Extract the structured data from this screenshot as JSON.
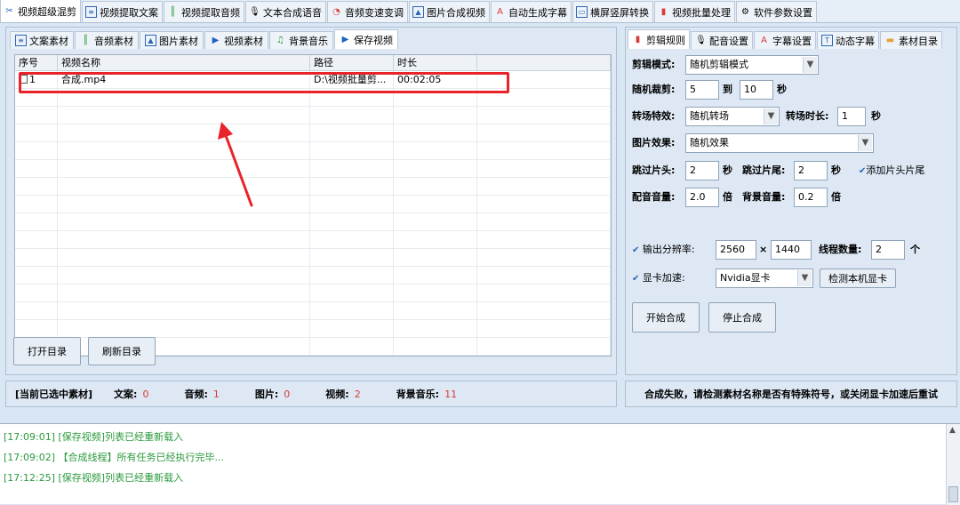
{
  "top_tabs": [
    {
      "label": "视频超级混剪",
      "icon": "scissors-icon",
      "active": true
    },
    {
      "label": "视频提取文案",
      "icon": "document-icon"
    },
    {
      "label": "视频提取音频",
      "icon": "audio-wave-icon"
    },
    {
      "label": "文本合成语音",
      "icon": "microphone-icon"
    },
    {
      "label": "音频变速变调",
      "icon": "speed-gauge-icon"
    },
    {
      "label": "图片合成视频",
      "icon": "image-icon"
    },
    {
      "label": "自动生成字幕",
      "icon": "subtitle-icon"
    },
    {
      "label": "横屏竖屏转换",
      "icon": "rotate-screen-icon"
    },
    {
      "label": "视频批量处理",
      "icon": "film-icon"
    },
    {
      "label": "软件参数设置",
      "icon": "gear-icon"
    }
  ],
  "sub_tabs": [
    {
      "label": "文案素材",
      "icon": "document-icon"
    },
    {
      "label": "音频素材",
      "icon": "audio-wave-icon"
    },
    {
      "label": "图片素材",
      "icon": "image-icon"
    },
    {
      "label": "视频素材",
      "icon": "play-icon"
    },
    {
      "label": "背景音乐",
      "icon": "music-note-icon"
    },
    {
      "label": "保存视频",
      "icon": "play-box-icon",
      "active": true
    }
  ],
  "table": {
    "headers": [
      "序号",
      "视频名称",
      "路径",
      "时长",
      ""
    ],
    "rows": [
      {
        "index": "1",
        "name": "合成.mp4",
        "path": "D:\\视频批量剪...",
        "duration": "00:02:05"
      }
    ]
  },
  "buttons": {
    "open_dir": "打开目录",
    "refresh_dir": "刷新目录"
  },
  "right_tabs": [
    {
      "label": "剪辑规则",
      "icon": "film-icon",
      "active": true
    },
    {
      "label": "配音设置",
      "icon": "microphone-icon"
    },
    {
      "label": "字幕设置",
      "icon": "subtitle-icon"
    },
    {
      "label": "动态字幕",
      "icon": "text-box-icon"
    },
    {
      "label": "素材目录",
      "icon": "folder-icon"
    }
  ],
  "settings": {
    "edit_mode_label": "剪辑模式:",
    "edit_mode_value": "随机剪辑模式",
    "random_cut_label": "随机裁剪:",
    "random_cut_from": "5",
    "to_label": "到",
    "random_cut_to": "10",
    "sec_unit": "秒",
    "transition_label": "转场特效:",
    "transition_value": "随机转场",
    "transition_duration_label": "转场时长:",
    "transition_duration_value": "1",
    "image_effect_label": "图片效果:",
    "image_effect_value": "随机效果",
    "skip_head_label": "跳过片头:",
    "skip_head_value": "2",
    "skip_tail_label": "跳过片尾:",
    "skip_tail_value": "2",
    "add_head_tail_label": "添加片头片尾",
    "voice_volume_label": "配音音量:",
    "voice_volume_value": "2.0",
    "times_unit": "倍",
    "bgm_volume_label": "背景音量:",
    "bgm_volume_value": "0.2",
    "output_res_label": "输出分辨率:",
    "res_width": "2560",
    "res_x": "×",
    "res_height": "1440",
    "threads_label": "线程数量:",
    "threads_value": "2",
    "threads_unit": "个",
    "gpu_label": "显卡加速:",
    "gpu_value": "Nvidia显卡",
    "detect_gpu_button": "检测本机显卡",
    "start_button": "开始合成",
    "stop_button": "停止合成"
  },
  "status": {
    "selected_label": "[当前已选中素材]",
    "text_label": "文案:",
    "text_count": "0",
    "audio_label": "音频:",
    "audio_count": "1",
    "image_label": "图片:",
    "image_count": "0",
    "video_label": "视频:",
    "video_count": "2",
    "bgm_label": "背景音乐:",
    "bgm_count": "11",
    "error_message": "合成失败，请检测素材名称是否有特殊符号，或关闭显卡加速后重试"
  },
  "log": [
    "[17:09:01] [保存视频]列表已经重新载入",
    "[17:09:02] 【合成线程】所有任务已经执行完毕...",
    "[17:12:25] [保存视频]列表已经重新载入"
  ],
  "colors": {
    "accent_red": "#e8232a",
    "log_green": "#2a9a3c",
    "count_red": "#d93b3b"
  }
}
